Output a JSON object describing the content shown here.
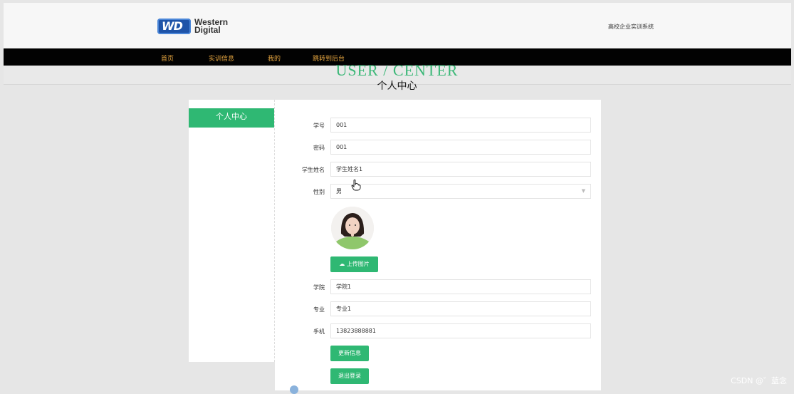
{
  "header": {
    "logo_line1": "Western",
    "logo_line2": "Digital",
    "logo_mark": "WD",
    "system_name": "高校企业实训系统"
  },
  "nav": {
    "items": [
      "首页",
      "实训信息",
      "我的",
      "跳转到后台"
    ],
    "color": "#e6a640"
  },
  "page": {
    "subtitle": "USER / CENTER",
    "title": "个人中心"
  },
  "sidebar": {
    "items": [
      "个人中心"
    ],
    "active_color": "#2fb873"
  },
  "form": {
    "student_id_label": "学号",
    "student_id_value": "001",
    "password_label": "密码",
    "password_value": "001",
    "name_label": "学生姓名",
    "name_value": "学生姓名1",
    "gender_label": "性别",
    "gender_value": "男",
    "upload_label": "上传图片",
    "college_label": "学院",
    "college_value": "学院1",
    "major_label": "专业",
    "major_value": "专业1",
    "phone_label": "手机",
    "phone_value": "13823888881",
    "update_button": "更新信息",
    "logout_button": "退出登录"
  },
  "watermark": "CSDN @゛蓝念",
  "icons": {
    "upload": "cloud-upload-icon",
    "select": "chevron-down-icon",
    "cursor": "hand-pointer-icon"
  }
}
